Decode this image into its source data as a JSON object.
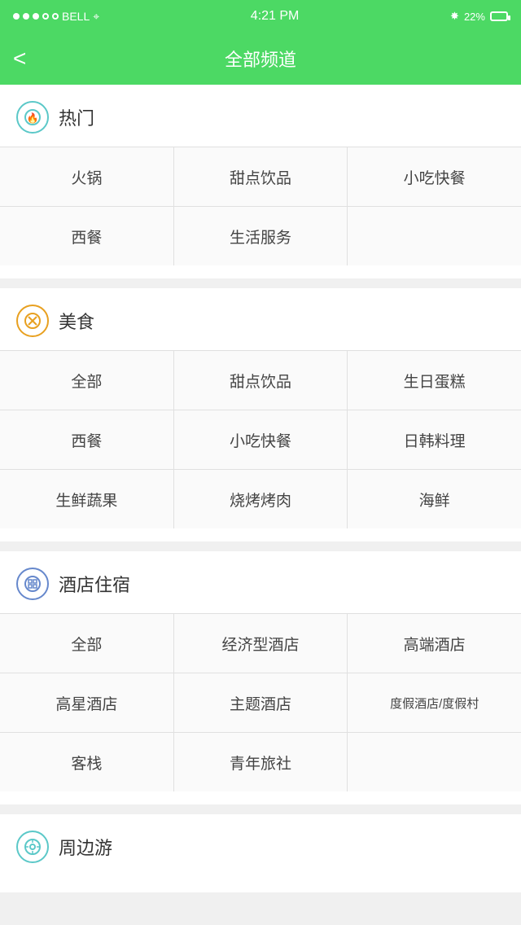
{
  "statusBar": {
    "carrier": "BELL",
    "time": "4:21 PM",
    "battery": "22%"
  },
  "navBar": {
    "backLabel": "<",
    "title": "全部频道"
  },
  "sections": [
    {
      "id": "hot",
      "iconType": "hot",
      "iconSymbol": "🔥",
      "title": "热门",
      "items": [
        [
          "火锅",
          "甜点饮品",
          "小吃快餐"
        ],
        [
          "西餐",
          "生活服务",
          ""
        ]
      ]
    },
    {
      "id": "food",
      "iconType": "food",
      "iconSymbol": "✕",
      "title": "美食",
      "items": [
        [
          "全部",
          "甜点饮品",
          "生日蛋糕"
        ],
        [
          "西餐",
          "小吃快餐",
          "日韩料理"
        ],
        [
          "生鲜蔬果",
          "烧烤烤肉",
          "海鲜"
        ]
      ]
    },
    {
      "id": "hotel",
      "iconType": "hotel",
      "iconSymbol": "⊞",
      "title": "酒店住宿",
      "items": [
        [
          "全部",
          "经济型酒店",
          "高端酒店"
        ],
        [
          "高星酒店",
          "主题酒店",
          "度假酒店/度假村"
        ],
        [
          "客栈",
          "青年旅社",
          ""
        ]
      ]
    },
    {
      "id": "travel",
      "iconType": "travel",
      "iconSymbol": "⊙",
      "title": "周边游",
      "items": []
    }
  ]
}
